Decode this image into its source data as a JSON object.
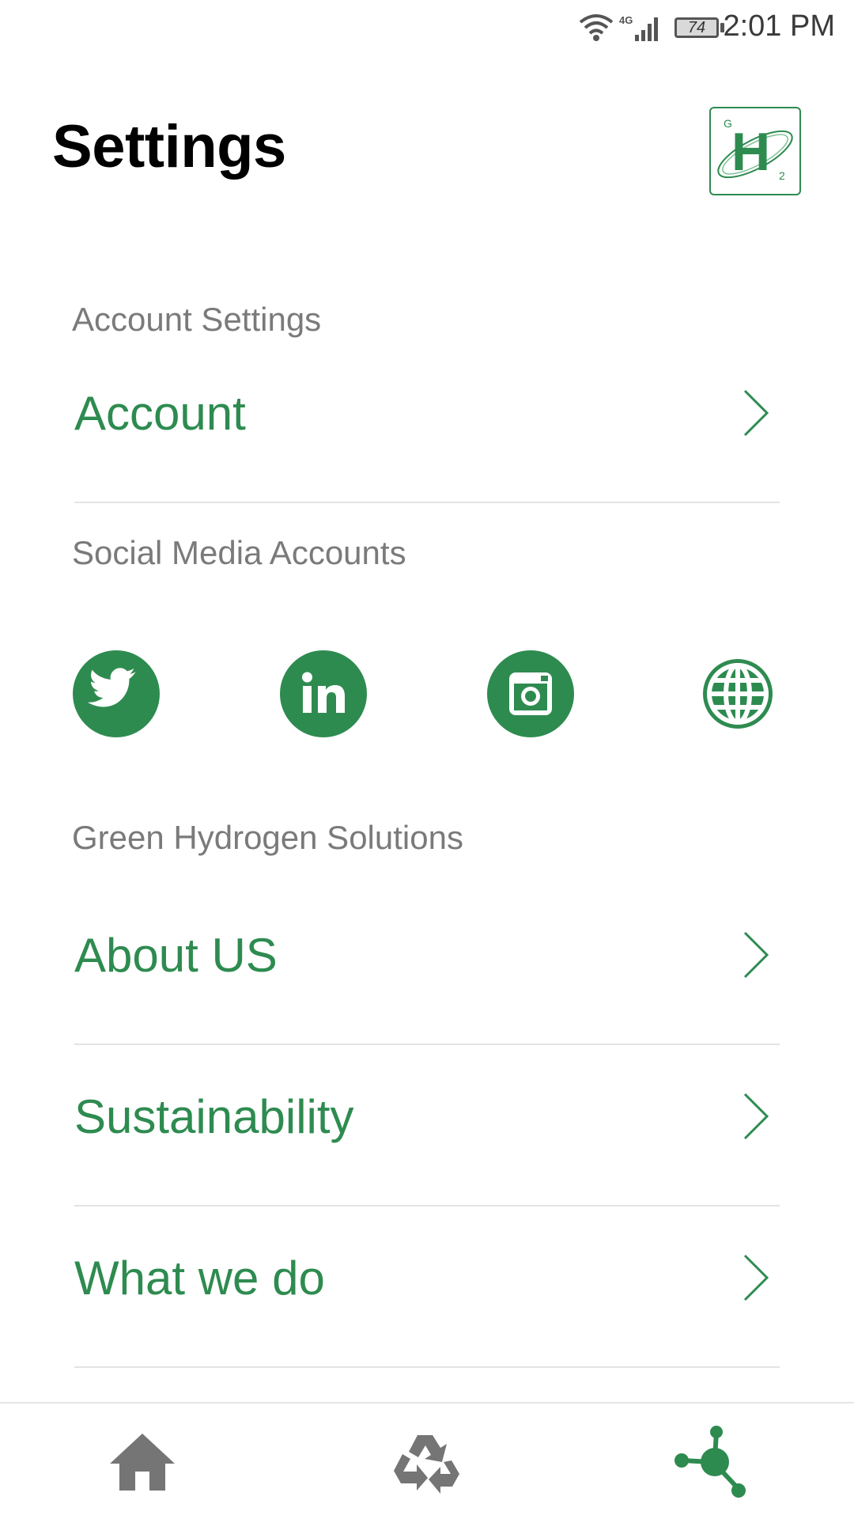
{
  "status_bar": {
    "time": "2:01 PM",
    "battery_level": "74",
    "network": "4G",
    "icons": [
      "wifi-icon",
      "cellular-signal-icon",
      "battery-icon"
    ]
  },
  "header": {
    "title": "Settings",
    "logo": {
      "icon": "green-hydrogen-logo",
      "letters": [
        "G",
        "H",
        "2"
      ]
    }
  },
  "sections": {
    "account": {
      "label": "Account Settings",
      "items": [
        {
          "label": "Account"
        }
      ]
    },
    "social": {
      "label": "Social Media Accounts",
      "icons": [
        "twitter-icon",
        "linkedin-icon",
        "instagram-icon",
        "globe-icon"
      ]
    },
    "company": {
      "label": "Green Hydrogen Solutions",
      "items": [
        {
          "label": "About US"
        },
        {
          "label": "Sustainability"
        },
        {
          "label": "What we do"
        }
      ]
    }
  },
  "bottom_nav": {
    "items": [
      {
        "icon": "home-icon",
        "active": false
      },
      {
        "icon": "recycle-icon",
        "active": false
      },
      {
        "icon": "network-nodes-icon",
        "active": true
      }
    ]
  },
  "colors": {
    "accent": "#2e8b50",
    "section_label": "#7a7a7a",
    "inactive_icon": "#757575",
    "divider": "#e3e3e3"
  }
}
